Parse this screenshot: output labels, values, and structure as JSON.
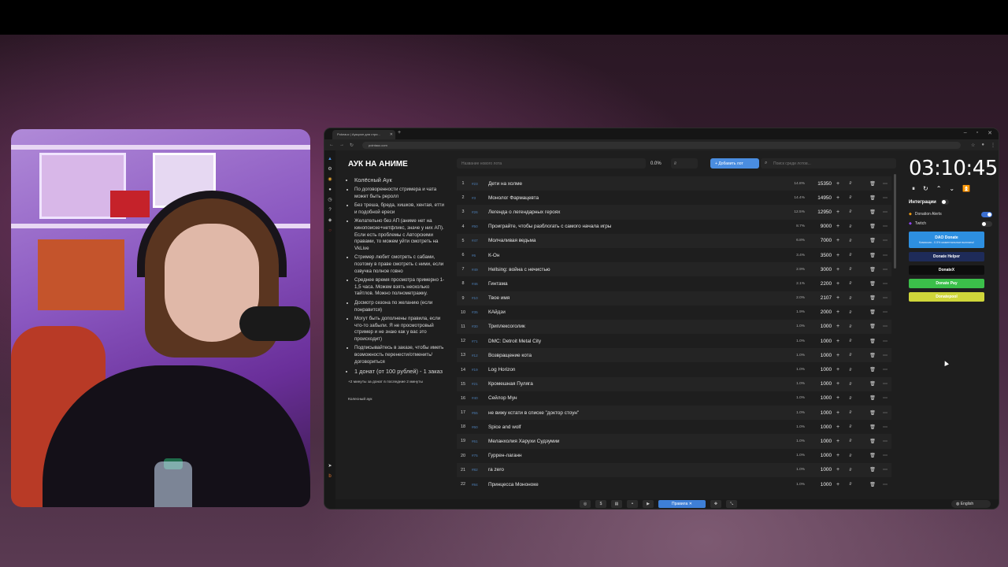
{
  "browser": {
    "tab_title": "Pokeauc | Аукцион для стри...",
    "url": "pointauc.com"
  },
  "rules": {
    "title": "АУК НА АНИМЕ",
    "heading": "Колёсный Аук",
    "items": [
      "По договоренности стримера и чата может быть реролл",
      "Без треша, бреда, хишков, хентая, етти и подобной ереси",
      "Желательно без АП (аниме нет на кинопоиске+нетфликс, значе у них АП). Если есть проблемы с Авторскими правами, то можем уйти смотреть на VkLive",
      "Стример любит смотреть с сабами, поэтому в праве смотреть с ними, если озвучка полное говно",
      "Среднее время просмотра примерно 1-1,5 часа. Можем взять несколько тайтлов. Можно полнометражку.",
      "Досмотр сезона по желанию (если понравится)",
      "Могут быть дополнены правила, если что-то забыли. Я не просмотровый стример и не знаю как у вас это происходит)",
      "Подписывайтесь в заказе, чтобы иметь возможность перенести/отменить/договориться"
    ],
    "big_item": "1 донат (от 100 рублей) - 1 заказ",
    "note": "+2 минуты за донат в последние 2 минуты",
    "footer": "Колесный аук"
  },
  "toolbar": {
    "lot_placeholder": "Название нового лота",
    "percent": "0.0%",
    "sum_placeholder": "₽",
    "add_label": "Добавить лот",
    "search_placeholder": "Поиск среди лотов..."
  },
  "lots": [
    {
      "n": "1",
      "code": "#23",
      "name": "Дети на холме",
      "pct": "14.8%",
      "amount": "15350"
    },
    {
      "n": "2",
      "code": "#3",
      "name": "Монолог Фармацевта",
      "pct": "14.4%",
      "amount": "14950"
    },
    {
      "n": "3",
      "code": "#26",
      "name": "Легенда о легендарных героях",
      "pct": "12.5%",
      "amount": "12950"
    },
    {
      "n": "4",
      "code": "#50",
      "name": "Проиграйте, чтобы разблогать с самого начала игры",
      "pct": "8.7%",
      "amount": "9000"
    },
    {
      "n": "5",
      "code": "#47",
      "name": "Молчаливая ведьма",
      "pct": "6.8%",
      "amount": "7000"
    },
    {
      "n": "6",
      "code": "#6",
      "name": "К-Он",
      "pct": "3.4%",
      "amount": "3500"
    },
    {
      "n": "7",
      "code": "#49",
      "name": "Hellsing: война с нечистью",
      "pct": "2.9%",
      "amount": "3000"
    },
    {
      "n": "8",
      "code": "#46",
      "name": "Гинтама",
      "pct": "2.1%",
      "amount": "2200"
    },
    {
      "n": "9",
      "code": "#10",
      "name": "Твое имя",
      "pct": "2.0%",
      "amount": "2107"
    },
    {
      "n": "10",
      "code": "#35",
      "name": "КАйдзи",
      "pct": "1.9%",
      "amount": "2000"
    },
    {
      "n": "11",
      "code": "#30",
      "name": "Триплексоголик",
      "pct": "1.0%",
      "amount": "1000"
    },
    {
      "n": "12",
      "code": "#71",
      "name": "DMC: Detroit Metal City",
      "pct": "1.0%",
      "amount": "1000"
    },
    {
      "n": "13",
      "code": "#12",
      "name": "Возвращение кота",
      "pct": "1.0%",
      "amount": "1000"
    },
    {
      "n": "14",
      "code": "#19",
      "name": "Log Horizon",
      "pct": "1.0%",
      "amount": "1000"
    },
    {
      "n": "15",
      "code": "#21",
      "name": "Кромешная Пуляга",
      "pct": "1.0%",
      "amount": "1000"
    },
    {
      "n": "16",
      "code": "#40",
      "name": "Сейлор Мун",
      "pct": "1.0%",
      "amount": "1000"
    },
    {
      "n": "17",
      "code": "#55",
      "name": "не вижу кстати в списке \"доктор стоун\"",
      "pct": "1.0%",
      "amount": "1000"
    },
    {
      "n": "18",
      "code": "#60",
      "name": "Spice and wolf",
      "pct": "1.0%",
      "amount": "1000"
    },
    {
      "n": "19",
      "code": "#61",
      "name": "Меланхолия Харухи Судзумии",
      "pct": "1.0%",
      "amount": "1000"
    },
    {
      "n": "20",
      "code": "#75",
      "name": "Гуррен-лаганн",
      "pct": "1.0%",
      "amount": "1000"
    },
    {
      "n": "21",
      "code": "#82",
      "name": "ra zero",
      "pct": "1.0%",
      "amount": "1000"
    },
    {
      "n": "22",
      "code": "#84",
      "name": "Принцесса Мононоке",
      "pct": "1.0%",
      "amount": "1000"
    }
  ],
  "row_actions": {
    "plus": "+",
    "rub": "₽",
    "trash": "🗑",
    "more": "⋯"
  },
  "timer": {
    "value": "03:10:45",
    "controls": [
      "⏸",
      "↻",
      "⌃",
      "⌄",
      "⏫"
    ]
  },
  "integrations": {
    "title": "Интеграции",
    "items": [
      {
        "name": "Donation Alerts",
        "on": true
      },
      {
        "name": "Twitch",
        "on": false
      }
    ],
    "tiles": [
      {
        "label": "DAO Donate",
        "sub": "Комиссия - 0.5% моментальные выплаты!",
        "color": "#2d8fe0"
      },
      {
        "label": "Donate Helper",
        "color": "#1e2b59"
      },
      {
        "label": "DonateX",
        "color": "#0d0d0d"
      },
      {
        "label": "Donate Pay",
        "color": "#3bbf4a"
      },
      {
        "label": "Donatepool",
        "color": "#cfd63a"
      }
    ]
  },
  "bottombar": {
    "active_label": "Правила",
    "lang": "English"
  }
}
